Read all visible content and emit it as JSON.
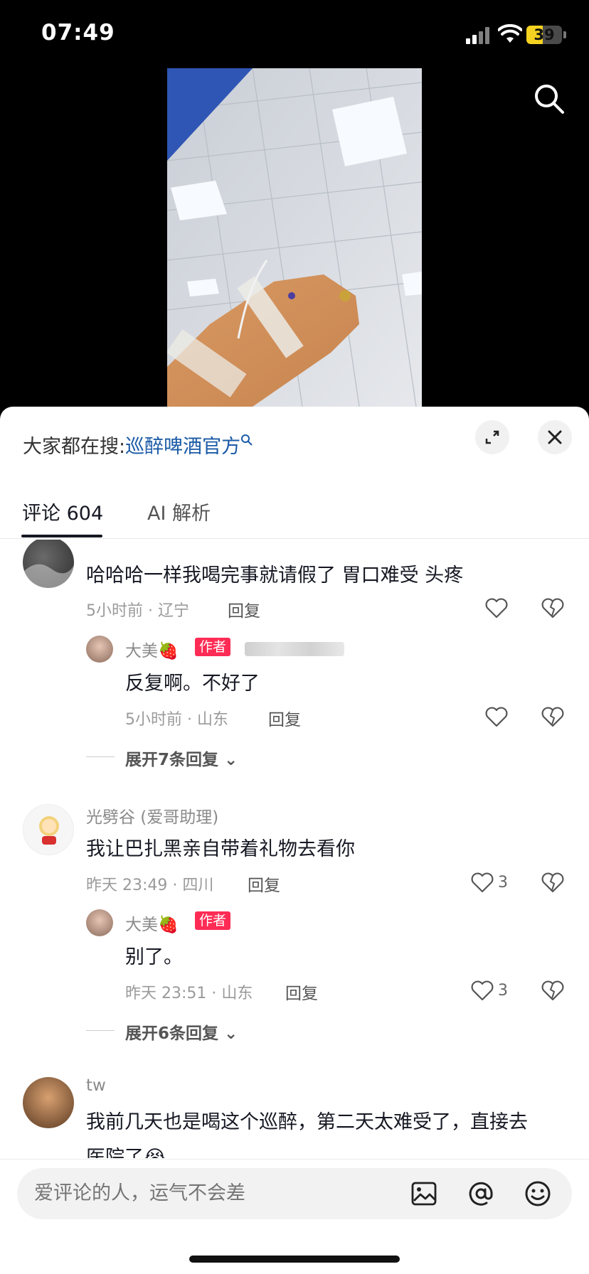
{
  "status_bar": {
    "time": "07:49",
    "battery": "39"
  },
  "trending": {
    "prefix": "大家都在搜:",
    "keyword": "巡醉啤酒官方"
  },
  "tabs": [
    {
      "label": "评论 604"
    },
    {
      "label": "AI 解析"
    }
  ],
  "comments": [
    {
      "text": "哈哈哈一样我喝完事就请假了 胃口难受 头疼",
      "time_loc": "5小时前 · 辽宁",
      "reply": "回复",
      "likes": "",
      "replies": [
        {
          "user": "大美🍓",
          "tag": "作者",
          "text": "反复啊。不好了",
          "time_loc": "5小时前 · 山东",
          "reply": "回复",
          "likes": ""
        }
      ],
      "expand": "展开7条回复"
    },
    {
      "user": "光劈谷 (爱哥助理)",
      "text": "我让巴扎黑亲自带着礼物去看你",
      "time_loc": "昨天 23:49 · 四川",
      "reply": "回复",
      "likes": "3",
      "replies": [
        {
          "user": "大美🍓",
          "tag": "作者",
          "text": "别了。",
          "time_loc": "昨天 23:51 · 山东",
          "reply": "回复",
          "likes": "3"
        }
      ],
      "expand": "展开6条回复"
    },
    {
      "user": "tw",
      "text_line1": "我前几天也是喝这个巡醉，第二天太难受了，直接去",
      "text_line2": "医院了😭"
    }
  ],
  "input": {
    "placeholder": "爱评论的人，运气不会差"
  },
  "icons": [
    "search-icon",
    "expand-icon",
    "close-icon",
    "heart-icon",
    "broken-heart-icon",
    "image-icon",
    "at-icon",
    "emoji-icon",
    "chevron-down-icon"
  ],
  "colors": {
    "author_tag": "#fe2c55",
    "keyword": "#1a5aa6",
    "battery": "#f5d21f"
  }
}
